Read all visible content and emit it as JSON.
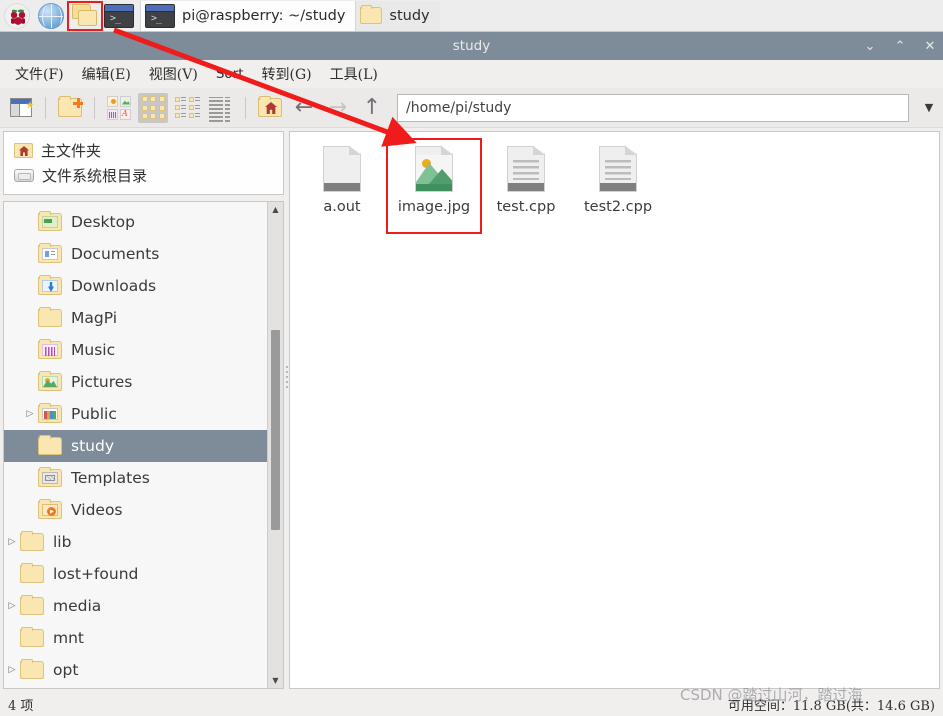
{
  "taskbar": {
    "launchers": [
      {
        "name": "raspberry-menu-icon",
        "label": ""
      },
      {
        "name": "web-browser-icon",
        "label": ""
      },
      {
        "name": "file-manager-icon",
        "label": "",
        "selected": true
      },
      {
        "name": "terminal-icon",
        "label": ""
      }
    ],
    "windows": [
      {
        "label": "pi@raspberry: ~/study",
        "icon": "terminal-icon",
        "active": true
      },
      {
        "label": "study",
        "icon": "folder-icon",
        "active": false
      }
    ]
  },
  "window": {
    "title": "study",
    "controls": {
      "minimize": "⌄",
      "maximize": "⌃",
      "close": "✕"
    }
  },
  "menubar": {
    "items": [
      {
        "label": "文件(F)",
        "latin": false
      },
      {
        "label": "编辑(E)",
        "latin": false
      },
      {
        "label": "视图(V)",
        "latin": false
      },
      {
        "label": "Sort",
        "latin": true
      },
      {
        "label": "转到(G)",
        "latin": false
      },
      {
        "label": "工具(L)",
        "latin": false
      }
    ]
  },
  "toolbar": {
    "buttons": [
      {
        "name": "new-tab-icon",
        "tip": "New Tab"
      },
      {
        "name": "new-folder-icon",
        "tip": "New Folder"
      },
      {
        "name": "thumbnail-view-icon",
        "tip": "Thumbnail View"
      },
      {
        "name": "icon-view-icon",
        "tip": "Icon View",
        "active": true
      },
      {
        "name": "detailed-list-view-icon",
        "tip": "Detailed List View"
      },
      {
        "name": "compact-view-icon",
        "tip": "Compact View"
      },
      {
        "name": "home-folder-icon",
        "tip": "Home Folder"
      },
      {
        "name": "back-arrow-icon",
        "tip": "Back",
        "glyph": "←"
      },
      {
        "name": "forward-arrow-icon",
        "tip": "Forward",
        "glyph": "→",
        "disabled": true
      },
      {
        "name": "up-arrow-icon",
        "tip": "Up",
        "glyph": "↑"
      }
    ],
    "path_value": "/home/pi/study",
    "path_placeholder": "/home/pi/study",
    "dropdown_glyph": "▼"
  },
  "sidebar": {
    "places": [
      {
        "label": "主文件夹",
        "icon": "home-folder-icon"
      },
      {
        "label": "文件系统根目录",
        "icon": "disk-icon"
      }
    ],
    "tree": [
      {
        "label": "Desktop",
        "indent": 2,
        "expander": "",
        "overlay": "desktop",
        "selected": false
      },
      {
        "label": "Documents",
        "indent": 2,
        "expander": "",
        "overlay": "documents",
        "selected": false
      },
      {
        "label": "Downloads",
        "indent": 2,
        "expander": "",
        "overlay": "downloads",
        "selected": false
      },
      {
        "label": "MagPi",
        "indent": 2,
        "expander": "",
        "overlay": "",
        "selected": false
      },
      {
        "label": "Music",
        "indent": 2,
        "expander": "",
        "overlay": "music",
        "selected": false
      },
      {
        "label": "Pictures",
        "indent": 2,
        "expander": "",
        "overlay": "pictures",
        "selected": false
      },
      {
        "label": "Public",
        "indent": 2,
        "expander": "▷",
        "overlay": "public",
        "selected": false
      },
      {
        "label": "study",
        "indent": 2,
        "expander": "",
        "overlay": "",
        "selected": true
      },
      {
        "label": "Templates",
        "indent": 2,
        "expander": "",
        "overlay": "templates",
        "selected": false
      },
      {
        "label": "Videos",
        "indent": 2,
        "expander": "",
        "overlay": "videos",
        "selected": false
      },
      {
        "label": "lib",
        "indent": 1,
        "expander": "▷",
        "overlay": "",
        "selected": false
      },
      {
        "label": "lost+found",
        "indent": 1,
        "expander": "",
        "overlay": "",
        "selected": false
      },
      {
        "label": "media",
        "indent": 1,
        "expander": "▷",
        "overlay": "",
        "selected": false
      },
      {
        "label": "mnt",
        "indent": 1,
        "expander": "",
        "overlay": "",
        "selected": false
      },
      {
        "label": "opt",
        "indent": 1,
        "expander": "▷",
        "overlay": "",
        "selected": false
      }
    ],
    "scrollbar": {
      "up_glyph": "▲",
      "down_glyph": "▼"
    }
  },
  "files": [
    {
      "name": "a.out",
      "kind": "binary",
      "selected": false
    },
    {
      "name": "image.jpg",
      "kind": "image",
      "selected": true
    },
    {
      "name": "test.cpp",
      "kind": "text",
      "selected": false
    },
    {
      "name": "test2.cpp",
      "kind": "text",
      "selected": false
    }
  ],
  "statusbar": {
    "item_count": "4 项",
    "free_space": "可用空间：11.8 GB(共：14.6 GB)"
  },
  "annotations": {
    "watermark": "CSDN @踏过山河，踏过海",
    "arrow_color": "#f01c1c",
    "highlight_color": "#f01c1c"
  }
}
